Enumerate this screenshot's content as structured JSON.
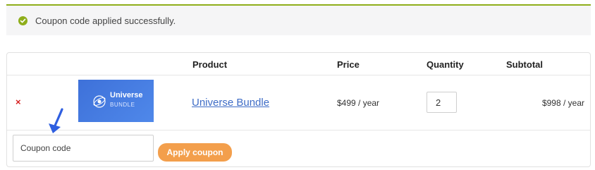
{
  "notice": {
    "message": "Coupon code applied successfully.",
    "icon": "check-circle-icon",
    "accent": "#8fae1b"
  },
  "cart": {
    "headers": {
      "product": "Product",
      "price": "Price",
      "quantity": "Quantity",
      "subtotal": "Subtotal"
    },
    "items": [
      {
        "remove_label": "×",
        "thumbnail": {
          "title": "Universe",
          "subtitle": "BUNDLE"
        },
        "product_name": "Universe Bundle",
        "price": "$499 / year",
        "quantity": "2",
        "subtotal": "$998 / year"
      }
    ],
    "coupon": {
      "placeholder": "Coupon code",
      "apply_label": "Apply coupon"
    }
  },
  "colors": {
    "apply_button": "#f39f4c",
    "link": "#3e6cc6",
    "remove": "#d61f1f",
    "annotation_arrow": "#2f5fe0"
  }
}
